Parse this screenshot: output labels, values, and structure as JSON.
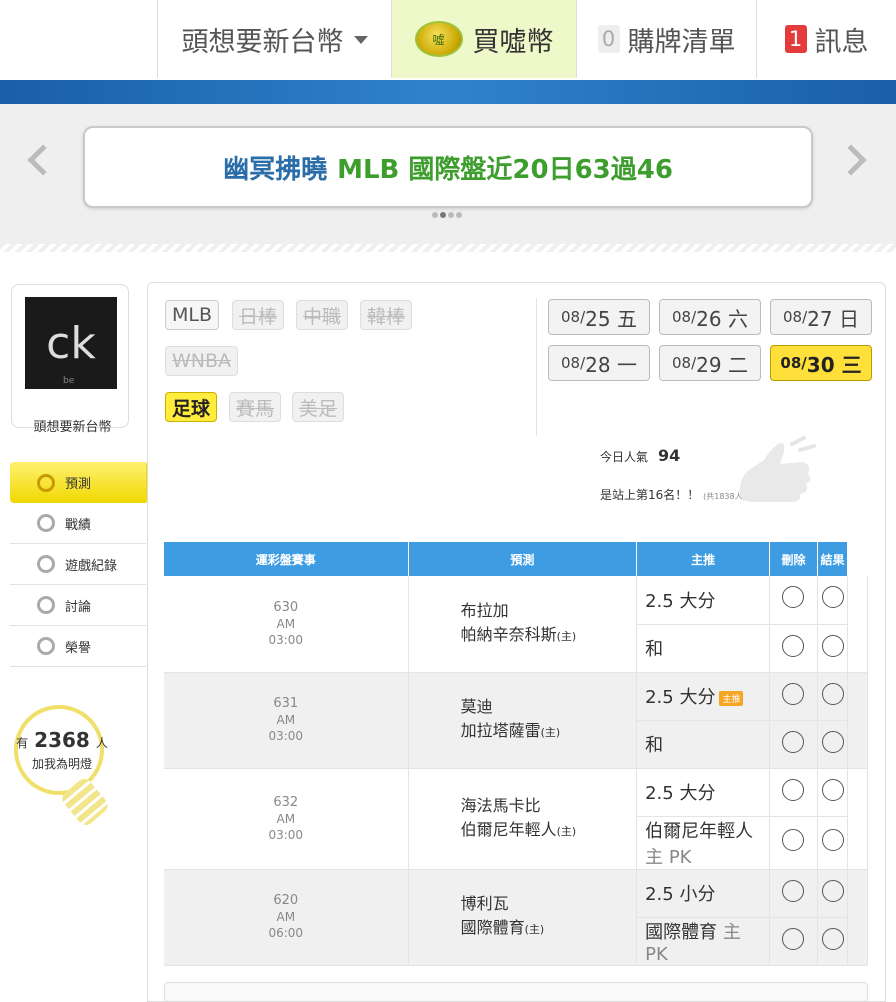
{
  "nav": {
    "username": "頭想要新台幣",
    "buy_label": "買噓幣",
    "coin_text": "噓",
    "cart_count": "0",
    "cart_label": "購牌清單",
    "msg_count": "1",
    "msg_label": "訊息"
  },
  "banner": {
    "name": "幽冥拂曉",
    "info": "MLB 國際盤近20日63過46"
  },
  "profile": {
    "avatar_text": "ck",
    "avatar_sub": "be",
    "name": "頭想要新台幣",
    "menu": [
      {
        "label": "預測",
        "icon": "target-icon"
      },
      {
        "label": "戰績",
        "icon": "medal-icon"
      },
      {
        "label": "遊戲紀錄",
        "icon": "record-icon"
      },
      {
        "label": "討論",
        "icon": "discuss-icon"
      },
      {
        "label": "榮譽",
        "icon": "award-icon"
      }
    ],
    "fans_prefix": "有",
    "fans_count": "2368",
    "fans_suffix": "人",
    "fans_cta": "加我為明燈"
  },
  "sports": [
    "MLB",
    "日棒",
    "中職",
    "韓棒",
    "WNBA",
    "足球",
    "賽馬",
    "美足"
  ],
  "dates": [
    {
      "md": "08/",
      "day": "25 五"
    },
    {
      "md": "08/",
      "day": "26 六"
    },
    {
      "md": "08/",
      "day": "27 日"
    },
    {
      "md": "08/",
      "day": "28 一"
    },
    {
      "md": "08/",
      "day": "29 二"
    },
    {
      "md": "08/",
      "day": "30 三"
    }
  ],
  "popularity": {
    "label": "今日人氣",
    "value": "94",
    "rank_text": "是站上第16名！！",
    "total": "(共1838人)"
  },
  "table": {
    "headers": [
      "運彩盤賽事",
      "預測",
      "主推",
      "刪除",
      "結果"
    ],
    "games": [
      {
        "num": "630",
        "ampm": "AM",
        "time": "03:00",
        "away": "布拉加",
        "home": "帕納辛奈科斯",
        "home_tag": "(主)",
        "pred1": "2.5 大分",
        "pred2": "和",
        "pred2_tag": "",
        "badge": ""
      },
      {
        "num": "631",
        "ampm": "AM",
        "time": "03:00",
        "away": "莫迪",
        "home": "加拉塔薩雷",
        "home_tag": "(主)",
        "pred1": "2.5 大分",
        "pred2": "和",
        "pred2_tag": "",
        "badge": "主推"
      },
      {
        "num": "632",
        "ampm": "AM",
        "time": "03:00",
        "away": "海法馬卡比",
        "home": "伯爾尼年輕人",
        "home_tag": "(主)",
        "pred1": "2.5 大分",
        "pred2": "伯爾尼年輕人",
        "pred2_tag": "主 PK",
        "badge": ""
      },
      {
        "num": "620",
        "ampm": "AM",
        "time": "06:00",
        "away": "博利瓦",
        "home": "國際體育",
        "home_tag": "(主)",
        "pred1": "2.5 小分",
        "pred2": "國際體育",
        "pred2_tag": "主 PK",
        "badge": ""
      }
    ]
  }
}
